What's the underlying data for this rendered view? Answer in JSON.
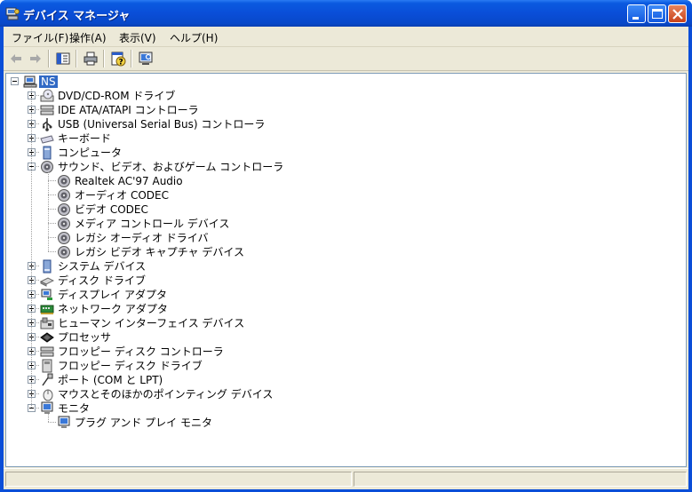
{
  "window": {
    "title": "デバイス マネージャ",
    "colors": {
      "titlebar": "#0a4ed8",
      "selection": "#316ac5",
      "chrome": "#ece9d8"
    }
  },
  "menu": [
    "ファイル(F)",
    "操作(A)",
    "表示(V)",
    "ヘルプ(H)"
  ],
  "toolbar": {
    "buttons": [
      {
        "name": "back-arrow-icon",
        "enabled": false
      },
      {
        "name": "forward-arrow-icon",
        "enabled": false
      },
      {
        "name": "show-hide-tree-icon",
        "enabled": true
      },
      {
        "name": "print-icon",
        "enabled": true
      },
      {
        "name": "properties-help-icon",
        "enabled": true
      },
      {
        "name": "scan-hardware-icon",
        "enabled": true
      }
    ]
  },
  "tree": {
    "root": "NS",
    "categories": [
      {
        "label": "DVD/CD-ROM ドライブ",
        "icon": "cdrom-icon",
        "expanded": false
      },
      {
        "label": "IDE ATA/ATAPI コントローラ",
        "icon": "ide-controller-icon",
        "expanded": false
      },
      {
        "label": "USB (Universal Serial Bus) コントローラ",
        "icon": "usb-icon",
        "expanded": false
      },
      {
        "label": "キーボード",
        "icon": "keyboard-icon",
        "expanded": false
      },
      {
        "label": "コンピュータ",
        "icon": "computer-icon",
        "expanded": false
      },
      {
        "label": "サウンド、ビデオ、およびゲーム コントローラ",
        "icon": "speaker-icon",
        "expanded": true,
        "children": [
          "Realtek AC'97 Audio",
          "オーディオ CODEC",
          "ビデオ CODEC",
          "メディア コントロール デバイス",
          "レガシ オーディオ ドライバ",
          "レガシ ビデオ キャプチャ デバイス"
        ]
      },
      {
        "label": "システム デバイス",
        "icon": "system-device-icon",
        "expanded": false
      },
      {
        "label": "ディスク ドライブ",
        "icon": "disk-drive-icon",
        "expanded": false
      },
      {
        "label": "ディスプレイ アダプタ",
        "icon": "display-adapter-icon",
        "expanded": false
      },
      {
        "label": "ネットワーク アダプタ",
        "icon": "network-adapter-icon",
        "expanded": false
      },
      {
        "label": "ヒューマン インターフェイス デバイス",
        "icon": "hid-icon",
        "expanded": false
      },
      {
        "label": "プロセッサ",
        "icon": "processor-icon",
        "expanded": false
      },
      {
        "label": "フロッピー ディスク コントローラ",
        "icon": "floppy-controller-icon",
        "expanded": false
      },
      {
        "label": "フロッピー ディスク ドライブ",
        "icon": "floppy-drive-icon",
        "expanded": false
      },
      {
        "label": "ポート (COM と LPT)",
        "icon": "port-icon",
        "expanded": false
      },
      {
        "label": "マウスとそのほかのポインティング デバイス",
        "icon": "mouse-icon",
        "expanded": false
      },
      {
        "label": "モニタ",
        "icon": "monitor-icon",
        "expanded": true,
        "children": [
          "プラグ アンド プレイ モニタ"
        ]
      }
    ]
  }
}
